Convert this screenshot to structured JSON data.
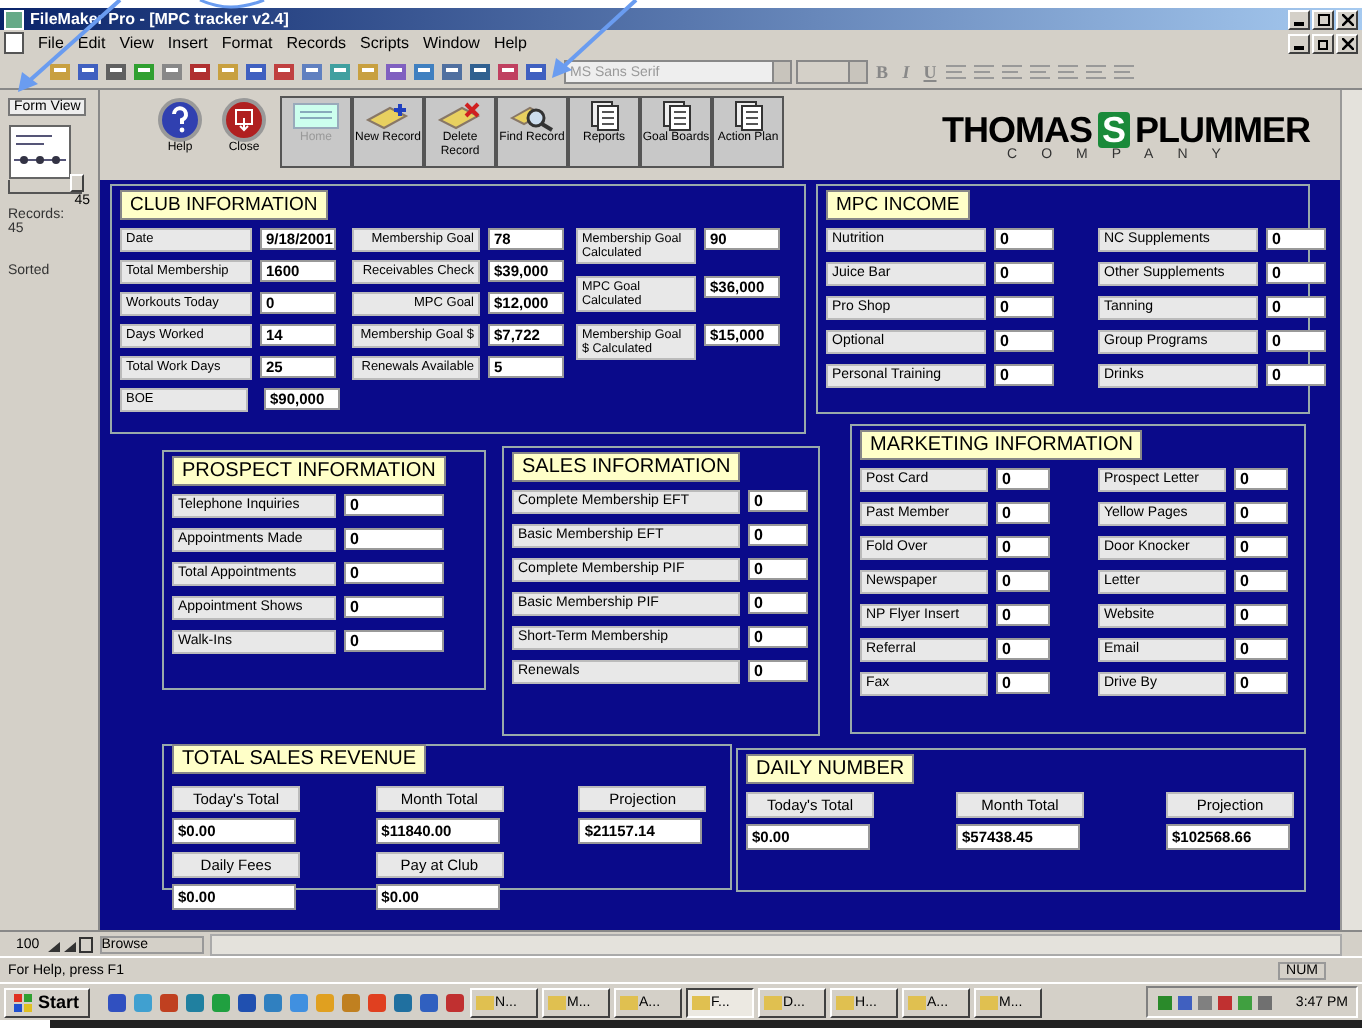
{
  "window": {
    "title": "FileMaker Pro - [MPC tracker  v2.4]"
  },
  "menu": [
    "File",
    "Edit",
    "View",
    "Insert",
    "Format",
    "Records",
    "Scripts",
    "Window",
    "Help"
  ],
  "toolbar": {
    "font": "MS Sans Serif",
    "format_buttons": [
      "B",
      "I",
      "U"
    ]
  },
  "sidebar": {
    "view_menu": "Form View",
    "record_number": "45",
    "slider": {
      "level": 1
    },
    "records_label": "Records:",
    "records_count": "45",
    "sort_state": "Sorted"
  },
  "nav_buttons": [
    {
      "label": "Help",
      "kind": "help",
      "disabled": false
    },
    {
      "label": "Close",
      "kind": "close",
      "disabled": false
    },
    {
      "label": "Home",
      "kind": "home",
      "disabled": true
    },
    {
      "label": "New Record",
      "kind": "new",
      "disabled": false
    },
    {
      "label": "Delete Record",
      "kind": "delete",
      "disabled": false
    },
    {
      "label": "Find Record",
      "kind": "find",
      "disabled": false
    },
    {
      "label": "Reports",
      "kind": "pages",
      "disabled": false
    },
    {
      "label": "Goal Boards",
      "kind": "pages",
      "disabled": false
    },
    {
      "label": "Action Plan",
      "kind": "pages",
      "disabled": false
    }
  ],
  "logo": {
    "left": "THOMAS",
    "mark": "S",
    "right": "PLUMMER",
    "subtitle": "COMPANY"
  },
  "club_information": {
    "title": "CLUB INFORMATION",
    "columns": [
      [
        {
          "label": "Date",
          "value": "9/18/2001"
        },
        {
          "label": "Total Membership",
          "value": "1600"
        },
        {
          "label": "Workouts Today",
          "value": "0"
        },
        {
          "label": "Days Worked",
          "value": "14"
        },
        {
          "label": "Total Work Days",
          "value": "25"
        },
        {
          "label": "BOE",
          "value": "$90,000"
        }
      ],
      [
        {
          "label": "Membership Goal",
          "value": "78"
        },
        {
          "label": "Receivables Check",
          "value": "$39,000"
        },
        {
          "label": "MPC Goal",
          "value": "$12,000"
        },
        {
          "label": "Membership Goal $",
          "value": "$7,722"
        },
        {
          "label": "Renewals Available",
          "value": "5"
        }
      ],
      [
        {
          "label": "Membership Goal Calculated",
          "value": "90"
        },
        {
          "label": "MPC Goal Calculated",
          "value": "$36,000"
        },
        {
          "label": "Membership Goal $ Calculated",
          "value": "$15,000"
        }
      ]
    ]
  },
  "mpc_income": {
    "title": "MPC INCOME",
    "columns": [
      [
        {
          "label": "Nutrition",
          "value": "0"
        },
        {
          "label": "Juice Bar",
          "value": "0"
        },
        {
          "label": "Pro Shop",
          "value": "0"
        },
        {
          "label": "Optional",
          "value": "0"
        },
        {
          "label": "Personal Training",
          "value": "0"
        }
      ],
      [
        {
          "label": "NC Supplements",
          "value": "0"
        },
        {
          "label": "Other Supplements",
          "value": "0"
        },
        {
          "label": "Tanning",
          "value": "0"
        },
        {
          "label": "Group Programs",
          "value": "0"
        },
        {
          "label": "Drinks",
          "value": "0"
        }
      ]
    ]
  },
  "prospect_information": {
    "title": "PROSPECT INFORMATION",
    "fields": [
      {
        "label": "Telephone Inquiries",
        "value": "0"
      },
      {
        "label": "Appointments Made",
        "value": "0"
      },
      {
        "label": "Total Appointments",
        "value": "0"
      },
      {
        "label": "Appointment Shows",
        "value": "0"
      },
      {
        "label": "Walk-Ins",
        "value": "0"
      }
    ]
  },
  "sales_information": {
    "title": "SALES INFORMATION",
    "fields": [
      {
        "label": "Complete Membership EFT",
        "value": "0"
      },
      {
        "label": "Basic Membership EFT",
        "value": "0"
      },
      {
        "label": "Complete Membership PIF",
        "value": "0"
      },
      {
        "label": "Basic Membership PIF",
        "value": "0"
      },
      {
        "label": "Short-Term Membership",
        "value": "0"
      },
      {
        "label": "Renewals",
        "value": "0"
      }
    ]
  },
  "marketing_information": {
    "title": "MARKETING INFORMATION",
    "columns": [
      [
        {
          "label": "Post Card",
          "value": "0"
        },
        {
          "label": "Past Member",
          "value": "0"
        },
        {
          "label": "Fold Over",
          "value": "0"
        },
        {
          "label": "Newspaper",
          "value": "0"
        },
        {
          "label": "NP Flyer Insert",
          "value": "0"
        },
        {
          "label": "Referral",
          "value": "0"
        },
        {
          "label": "Fax",
          "value": "0"
        }
      ],
      [
        {
          "label": "Prospect Letter",
          "value": "0"
        },
        {
          "label": "Yellow Pages",
          "value": "0"
        },
        {
          "label": "Door Knocker",
          "value": "0"
        },
        {
          "label": "Letter",
          "value": "0"
        },
        {
          "label": "Website",
          "value": "0"
        },
        {
          "label": "Email",
          "value": "0"
        },
        {
          "label": "Drive By",
          "value": "0"
        }
      ]
    ]
  },
  "total_sales_revenue": {
    "title": "TOTAL SALES REVENUE",
    "fields": [
      {
        "label": "Today's Total",
        "value": "$0.00"
      },
      {
        "label": "Month Total",
        "value": "$11840.00"
      },
      {
        "label": "Projection",
        "value": "$21157.14"
      },
      {
        "label": "Daily Fees",
        "value": "$0.00"
      },
      {
        "label": "Pay at Club",
        "value": "$0.00"
      }
    ]
  },
  "daily_number": {
    "title": "DAILY NUMBER",
    "fields": [
      {
        "label": "Today's Total",
        "value": "$0.00"
      },
      {
        "label": "Month Total",
        "value": "$57438.45"
      },
      {
        "label": "Projection",
        "value": "$102568.66"
      }
    ]
  },
  "bottom_bar": {
    "zoom": "100",
    "mode": "Browse"
  },
  "status_bar": {
    "hint": "For Help, press F1",
    "indicator": "NUM"
  },
  "taskbar": {
    "start": "Start",
    "tasks": [
      {
        "label": "N...",
        "selected": false
      },
      {
        "label": "M...",
        "selected": false
      },
      {
        "label": "A...",
        "selected": false
      },
      {
        "label": "F...",
        "selected": true
      },
      {
        "label": "D...",
        "selected": false
      },
      {
        "label": "H...",
        "selected": false
      },
      {
        "label": "A...",
        "selected": false
      },
      {
        "label": "M...",
        "selected": false
      }
    ],
    "clock": "3:47 PM"
  }
}
